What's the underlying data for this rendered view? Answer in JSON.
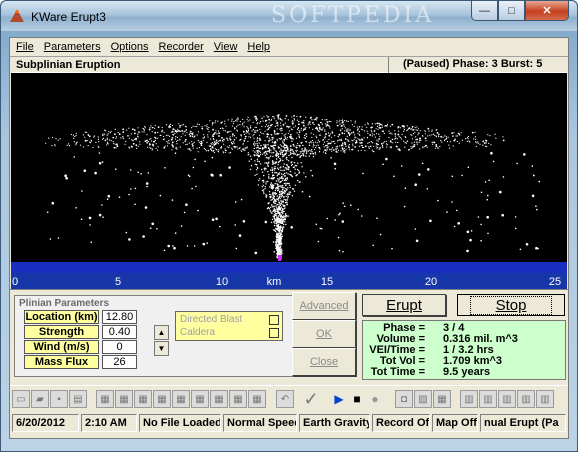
{
  "window": {
    "title": "KWare Erupt3",
    "watermark": "SOFTPEDIA",
    "min": "—",
    "max": "□",
    "close": "✕"
  },
  "menu": [
    "File",
    "Parameters",
    "Options",
    "Recorder",
    "View",
    "Help"
  ],
  "status": {
    "title": "Subplinian Eruption",
    "right": "(Paused) Phase: 3   Burst: 5"
  },
  "ruler": {
    "ticks": [
      "0",
      "5",
      "10",
      "km",
      "15",
      "20",
      "25"
    ],
    "tick_positions_km": [
      0,
      5,
      10,
      null,
      15,
      20,
      25
    ]
  },
  "params": {
    "title": "Plinian Parameters",
    "rows": [
      {
        "label": "Location (km)",
        "value": "12.80"
      },
      {
        "label": "Strength",
        "value": "0.40"
      },
      {
        "label": "Wind (m/s)",
        "value": "0"
      },
      {
        "label": "Mass Flux",
        "value": "26"
      }
    ],
    "checks": [
      {
        "label": "Directed Blast"
      },
      {
        "label": "Caldera"
      }
    ],
    "advanced": "Advanced",
    "ok": "OK",
    "close": "Close"
  },
  "erupt": "Erupt",
  "stop": "Stop",
  "info": [
    {
      "label": "Phase =",
      "value": "3 / 4"
    },
    {
      "label": "Volume =",
      "value": "0.316 mil. m^3"
    },
    {
      "label": "VEI/Time =",
      "value": "1 / 3.2 hrs"
    },
    {
      "label": "Tot Vol =",
      "value": "1.709 km^3"
    },
    {
      "label": "Tot Time =",
      "value": "9.5 years"
    }
  ],
  "statusbar": [
    "6/20/2012",
    "2:10 AM",
    "No File Loaded",
    "Normal Speed",
    "Earth Gravity",
    "Record Off",
    "Map Off",
    "nual Erupt (Pa"
  ],
  "colors": {
    "ground": "#1a2ebf",
    "ruler": "#1736a8",
    "params_bg": "#ffff9f",
    "info_bg": "#ccffcc",
    "accent_play": "#0044cc"
  }
}
